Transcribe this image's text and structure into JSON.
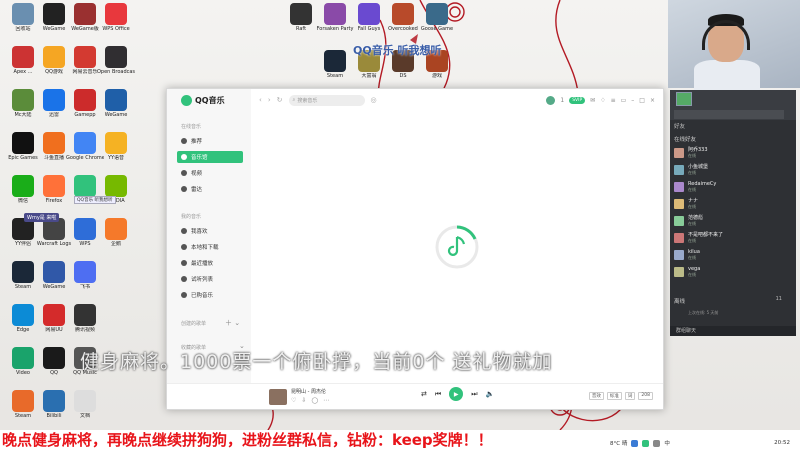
{
  "desktop_icons": [
    {
      "label": "回收站",
      "color": "#6a8fb0",
      "col": 0,
      "row": 0
    },
    {
      "label": "WeGame",
      "color": "#222222",
      "col": 1,
      "row": 0
    },
    {
      "label": "WeGame版",
      "color": "#9a3030",
      "col": 2,
      "row": 0
    },
    {
      "label": "WPS Office",
      "color": "#e8383d",
      "col": 3,
      "row": 0
    },
    {
      "label": "Apex ...",
      "color": "#cc3333",
      "col": 0,
      "row": 1
    },
    {
      "label": "QQ游戏",
      "color": "#f5a623",
      "col": 1,
      "row": 1
    },
    {
      "label": "网易云音乐",
      "color": "#d33a31",
      "col": 2,
      "row": 1
    },
    {
      "label": "Open Broadcaster",
      "color": "#302e31",
      "col": 3,
      "row": 1
    },
    {
      "label": "Mc大陆",
      "color": "#5b8c3a",
      "col": 0,
      "row": 2
    },
    {
      "label": "迅雷",
      "color": "#1a73e8",
      "col": 1,
      "row": 2
    },
    {
      "label": "Gamepp",
      "color": "#cc2b2b",
      "col": 2,
      "row": 2
    },
    {
      "label": "WeGame",
      "color": "#1f5fa8",
      "col": 3,
      "row": 2
    },
    {
      "label": "Epic Games",
      "color": "#111111",
      "col": 0,
      "row": 3
    },
    {
      "label": "斗鱼直播",
      "color": "#f06f1e",
      "col": 1,
      "row": 3
    },
    {
      "label": "Google Chrome",
      "color": "#4285f4",
      "col": 2,
      "row": 3
    },
    {
      "label": "YY语音",
      "color": "#f5b223",
      "col": 3,
      "row": 3
    },
    {
      "label": "微信",
      "color": "#1aad19",
      "col": 0,
      "row": 4
    },
    {
      "label": "Firefox",
      "color": "#ff7139",
      "col": 1,
      "row": 4
    },
    {
      "label": "QQ音乐",
      "color": "#31c27c",
      "col": 2,
      "row": 4
    },
    {
      "label": "NVIDIA",
      "color": "#76b900",
      "col": 3,
      "row": 4
    },
    {
      "label": "YY伴侣",
      "color": "#222222",
      "col": 0,
      "row": 5
    },
    {
      "label": "Warcraft Logs",
      "color": "#444444",
      "col": 1,
      "row": 5
    },
    {
      "label": "WPS",
      "color": "#2e6dd8",
      "col": 2,
      "row": 5
    },
    {
      "label": "企鹅",
      "color": "#f5792a",
      "col": 3,
      "row": 5
    },
    {
      "label": "Steam",
      "color": "#1b2838",
      "col": 0,
      "row": 6
    },
    {
      "label": "WeGame",
      "color": "#3058a8",
      "col": 1,
      "row": 6
    },
    {
      "label": "飞书",
      "color": "#4e6ef2",
      "col": 2,
      "row": 6
    },
    {
      "label": "Edge",
      "color": "#0c8bd6",
      "col": 0,
      "row": 7
    },
    {
      "label": "网易UU",
      "color": "#d42b2b",
      "col": 1,
      "row": 7
    },
    {
      "label": "腾讯视频",
      "color": "#333333",
      "col": 2,
      "row": 7
    },
    {
      "label": "Video",
      "color": "#1aa36b",
      "col": 0,
      "row": 8
    },
    {
      "label": "QQ",
      "color": "#1a1a1a",
      "col": 1,
      "row": 8
    },
    {
      "label": "QQ Music",
      "color": "#555555",
      "col": 2,
      "row": 8
    },
    {
      "label": "Steam",
      "color": "#e86a2a",
      "col": 0,
      "row": 9
    },
    {
      "label": "Bilibili",
      "color": "#2a6fb0",
      "col": 1,
      "row": 9
    },
    {
      "label": "文档",
      "color": "#dddddd",
      "col": 2,
      "row": 9
    }
  ],
  "top_icons": [
    {
      "label": "Raft",
      "color": "#333333"
    },
    {
      "label": "Forsaken Party",
      "color": "#8a4aa8"
    },
    {
      "label": "Fall Guys",
      "color": "#6a4ad0"
    },
    {
      "label": "Overcooked",
      "color": "#b84a2a"
    },
    {
      "label": "Goose Game",
      "color": "#3a6a8a"
    },
    {
      "label": "Steam",
      "color": "#1b2838"
    },
    {
      "label": "大富翁",
      "color": "#9a8a3a"
    },
    {
      "label": "DS",
      "color": "#5a3a2a"
    },
    {
      "label": "游戏",
      "color": "#aa4422"
    }
  ],
  "qq_overlay": "QQ音乐 听我想听",
  "tooltip": "QQ音乐 听我想听",
  "wechat_bar": "Wmy是 来啦",
  "qqmusic": {
    "title": "QQ音乐",
    "section_online": "在线音乐",
    "nav_online": [
      "推荐",
      "音乐馆",
      "视频",
      "雷达"
    ],
    "active_nav": "音乐馆",
    "section_mine": "我的音乐",
    "nav_mine": [
      "我喜欢",
      "本地和下载",
      "最近播放",
      "试听列表",
      "已购音乐"
    ],
    "section_created": "创建的歌单",
    "section_collected": "收藏的歌单",
    "search_placeholder": "搜索音乐",
    "vip_label": "SVIP",
    "user_count": "1",
    "song_title": "昆明山 - 周杰伦",
    "volume_label": "音效",
    "quality_label": "标准",
    "lyric_label": "词",
    "count_label": "208"
  },
  "friends": {
    "tab": "好友",
    "section_online": "在线好友",
    "list": [
      {
        "name": "阿乔333",
        "status": "在线"
      },
      {
        "name": "小鱼城堡",
        "status": "在线"
      },
      {
        "name": "RedaimeCy",
        "status": "在线"
      },
      {
        "name": "ナナ",
        "status": "在线"
      },
      {
        "name": "范德彪",
        "status": "在线"
      },
      {
        "name": "不是吧都不来了",
        "status": "在线"
      },
      {
        "name": "kilua",
        "status": "在线"
      },
      {
        "name": "vega",
        "status": "在线"
      }
    ],
    "section_offline": "离线",
    "offline_note": "上次在线: 5 天前",
    "group_chat": "群组聊天",
    "offline_count": "11"
  },
  "ticker": "健身麻将。1000票一个俯卧撑，当前0个 送礼物就加",
  "banner": "晚点健身麻将，再晚点继续拼狗狗，进粉丝群私信，钻粉：keep奖牌！！",
  "tray": {
    "weather": "8°C 晴",
    "time": "20:52",
    "lang": "中"
  }
}
